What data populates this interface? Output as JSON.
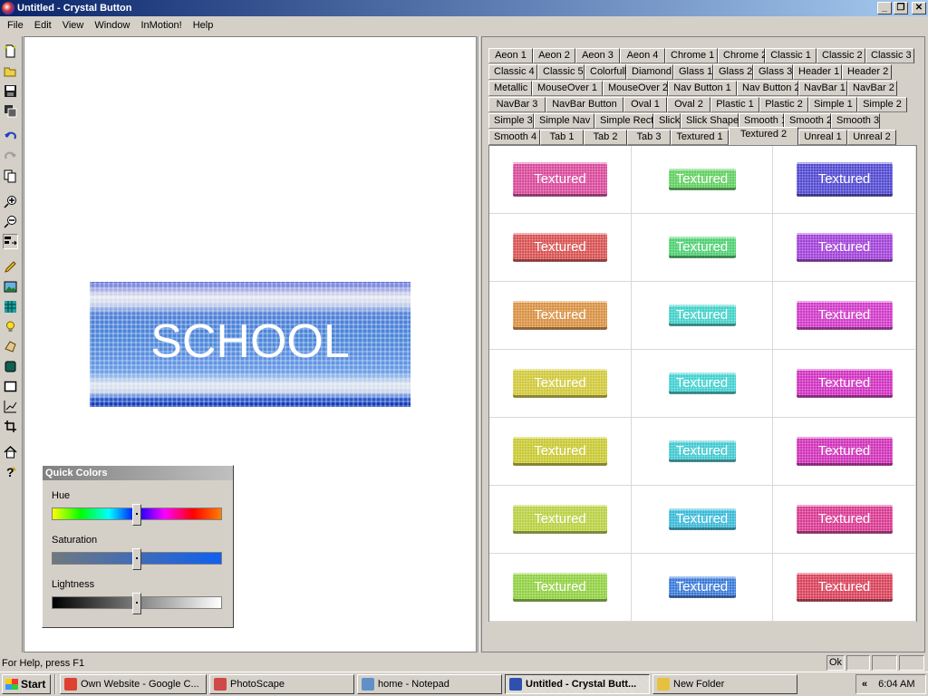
{
  "window": {
    "title": "Untitled - Crystal Button",
    "minimize": "_",
    "restore": "❐",
    "close": "✕"
  },
  "menu": [
    "File",
    "Edit",
    "View",
    "Window",
    "InMotion!",
    "Help"
  ],
  "toolbar_icons": [
    "new-icon",
    "open-icon",
    "save-icon",
    "export-icon",
    "undo-icon",
    "redo-icon",
    "copy-icon",
    "zoom-in-icon",
    "zoom-out-icon",
    "align-icon",
    "pencil-icon",
    "image-icon",
    "texture-icon",
    "light-icon",
    "shape-icon",
    "layer-icon",
    "rectangle-icon",
    "chart-icon",
    "crop-icon",
    "home-icon",
    "help-icon"
  ],
  "canvas": {
    "button_text": "SCHOOL"
  },
  "quick_colors": {
    "title": "Quick Colors",
    "hue_label": "Hue",
    "saturation_label": "Saturation",
    "lightness_label": "Lightness",
    "hue": 0.5,
    "saturation": 0.5,
    "lightness": 0.5
  },
  "tabs": {
    "rows": [
      [
        "Aeon 1",
        "Aeon 2",
        "Aeon 3",
        "Aeon 4",
        "Chrome 1",
        "Chrome 2",
        "Classic 1",
        "Classic 2",
        "Classic 3"
      ],
      [
        "Classic 4",
        "Classic 5",
        "Colorfull",
        "Diamond",
        "Glass 1",
        "Glass 2",
        "Glass 3",
        "Header 1",
        "Header 2"
      ],
      [
        "Metallic",
        "MouseOver 1",
        "MouseOver 2",
        "Nav Button 1",
        "Nav Button 2",
        "NavBar 1",
        "NavBar 2"
      ],
      [
        "NavBar 3",
        "NavBar Button",
        "Oval 1",
        "Oval 2",
        "Plastic 1",
        "Plastic 2",
        "Simple 1",
        "Simple 2"
      ],
      [
        "Simple 3",
        "Simple Nav",
        "Simple Rect",
        "Slick",
        "Slick Shape",
        "Smooth 1",
        "Smooth 2",
        "Smooth 3"
      ],
      [
        "Smooth 4",
        "Tab 1",
        "Tab 2",
        "Tab 3",
        "Textured 1",
        "Textured 2",
        "Unreal 1",
        "Unreal 2"
      ]
    ],
    "active": "Textured 2"
  },
  "gallery": {
    "label": "Textured",
    "colors": [
      "#d8489a",
      "#5ecf5e",
      "#5048d0",
      "#d85050",
      "#4ccf70",
      "#a040d8",
      "#d89040",
      "#40d0c8",
      "#d038c8",
      "#d0c838",
      "#40d0d0",
      "#d030c0",
      "#c8c830",
      "#40c8d0",
      "#d030b8",
      "#b8d040",
      "#38b8d8",
      "#d83890",
      "#90d040",
      "#3878d8",
      "#d84058"
    ]
  },
  "status": {
    "help_text": "For Help, press F1",
    "panel1": "Ok",
    "panel2": "",
    "panel3": "",
    "panel4": ""
  },
  "taskbar": {
    "start": "Start",
    "items": [
      {
        "label": "Own Website - Google C...",
        "icon": "chrome-icon",
        "color": "#e04030",
        "active": false
      },
      {
        "label": "PhotoScape",
        "icon": "photoscape-icon",
        "color": "#d04848",
        "active": false
      },
      {
        "label": "home - Notepad",
        "icon": "notepad-icon",
        "color": "#6090c8",
        "active": false
      },
      {
        "label": "Untitled - Crystal Butt...",
        "icon": "crystal-button-icon",
        "color": "#3050b0",
        "active": true
      },
      {
        "label": "New Folder",
        "icon": "folder-icon",
        "color": "#e8c040",
        "active": false
      }
    ],
    "tray_arrow": "«",
    "clock": "6:04 AM"
  }
}
